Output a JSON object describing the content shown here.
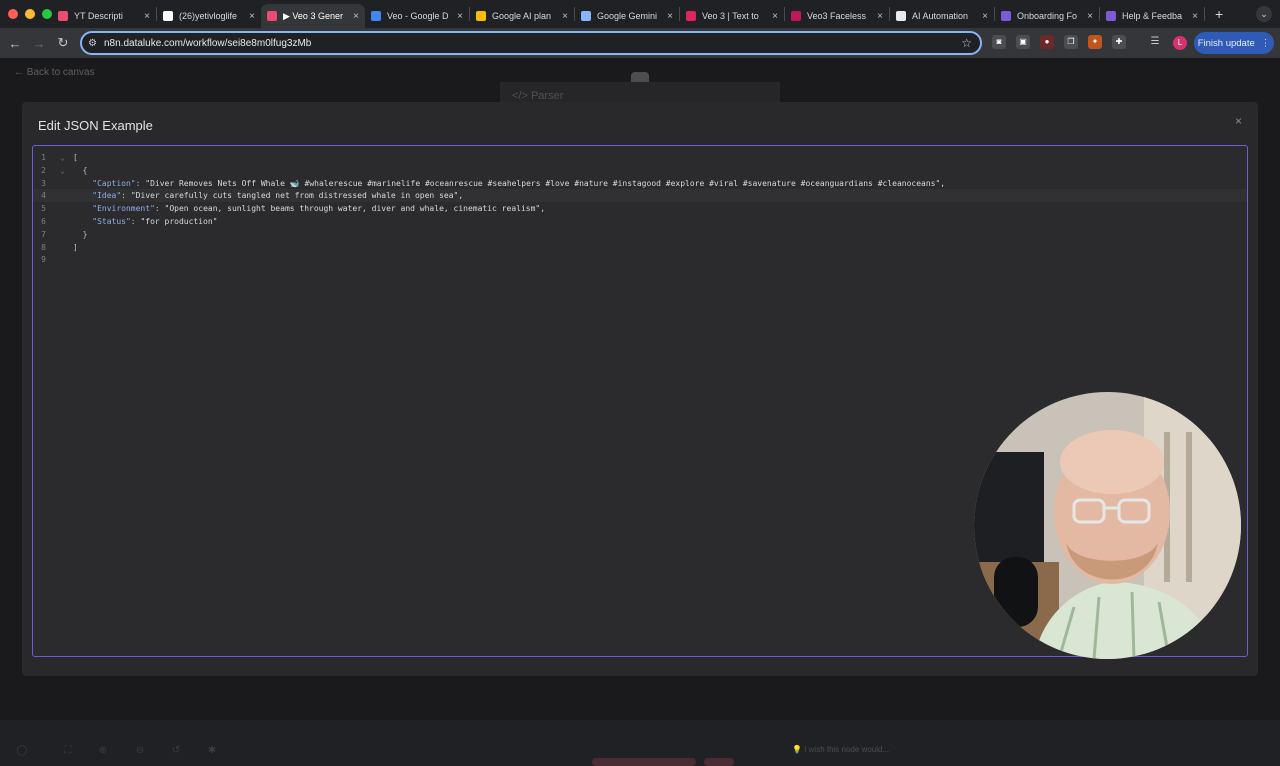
{
  "browser": {
    "tabs": [
      {
        "label": "YT Descripti",
        "icon": "n8n-icon",
        "color": "#ea4b71"
      },
      {
        "label": "(26)yetivloglife",
        "icon": "tiktok-icon",
        "color": "#ffffff"
      },
      {
        "label": "▶ Veo 3 Gener",
        "icon": "n8n-icon",
        "color": "#ea4b71",
        "active": true
      },
      {
        "label": "Veo - Google D",
        "icon": "google-deepmind-icon",
        "color": "#4285f4"
      },
      {
        "label": "Google AI plan",
        "icon": "google-icon",
        "color": "#fbbc04"
      },
      {
        "label": "Google Gemini",
        "icon": "gemini-icon",
        "color": "#8ab4f8"
      },
      {
        "label": "Veo 3 | Text to",
        "icon": "veo-icon",
        "color": "#e0245e"
      },
      {
        "label": "Veo3 Faceless",
        "icon": "veo3-icon",
        "color": "#c2185b"
      },
      {
        "label": "AI Automation",
        "icon": "skool-icon",
        "color": "#e8eaed"
      },
      {
        "label": "Onboarding Fo",
        "icon": "form-icon",
        "color": "#7b5cd6"
      },
      {
        "label": "Help & Feedba",
        "icon": "form-icon",
        "color": "#7b5cd6"
      }
    ],
    "new_tab": "+",
    "url": "n8n.dataluke.com/workflow/sei8e8m0lfug3zMb",
    "finish_update": "Finish update",
    "avatar_letter": "L"
  },
  "app": {
    "back_label": "Back to canvas",
    "parser_label": "</> Parser",
    "wish_text": "I wish this node would..."
  },
  "modal": {
    "title": "Edit JSON Example",
    "close": "×",
    "active_line": 4,
    "lines": [
      {
        "n": "1",
        "fold": "⌄",
        "text": "["
      },
      {
        "n": "2",
        "fold": "⌄",
        "text": "  {"
      },
      {
        "n": "3",
        "fold": "",
        "key": "    \"Caption\"",
        "value": "\"Diver Removes Nets Off Whale 🐋 #whalerescue #marinelife #oceanrescue #seahelpers #love #nature #instagood #explore #viral #savenature #oceanguardians #cleanoceans\","
      },
      {
        "n": "4",
        "fold": "",
        "key": "    \"Idea\"",
        "value": "\"Diver carefully cuts tangled net from distressed whale in open sea\","
      },
      {
        "n": "5",
        "fold": "",
        "key": "    \"Environment\"",
        "value": "\"Open ocean, sunlight beams through water, diver and whale, cinematic realism\","
      },
      {
        "n": "6",
        "fold": "",
        "key": "    \"Status\"",
        "value": "\"for production\""
      },
      {
        "n": "7",
        "fold": "",
        "text": "  }"
      },
      {
        "n": "8",
        "fold": "",
        "text": "]"
      },
      {
        "n": "9",
        "fold": "",
        "text": ""
      }
    ]
  }
}
